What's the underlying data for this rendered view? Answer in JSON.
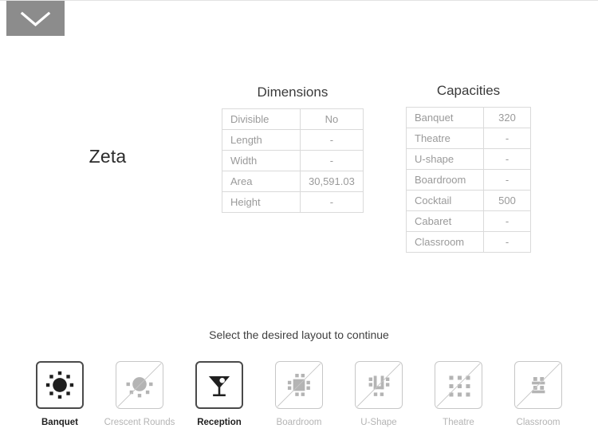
{
  "topbar": {
    "collapse_icon": "chevron-down-icon"
  },
  "room": {
    "name": "Zeta"
  },
  "dimensions": {
    "caption": "Dimensions",
    "rows": [
      {
        "label": "Divisible",
        "value": "No"
      },
      {
        "label": "Length",
        "value": "-"
      },
      {
        "label": "Width",
        "value": "-"
      },
      {
        "label": "Area",
        "value": "30,591.03"
      },
      {
        "label": "Height",
        "value": "-"
      }
    ]
  },
  "capacities": {
    "caption": "Capacities",
    "rows": [
      {
        "label": "Banquet",
        "value": "320"
      },
      {
        "label": "Theatre",
        "value": "-"
      },
      {
        "label": "U-shape",
        "value": "-"
      },
      {
        "label": "Boardroom",
        "value": "-"
      },
      {
        "label": "Cocktail",
        "value": "500"
      },
      {
        "label": "Cabaret",
        "value": "-"
      },
      {
        "label": "Classroom",
        "value": "-"
      }
    ]
  },
  "layout_selector": {
    "prompt": "Select the desired layout to continue",
    "options": [
      {
        "label": "Banquet",
        "icon": "banquet-round-table-icon",
        "enabled": true
      },
      {
        "label": "Crescent Rounds",
        "icon": "crescent-rounds-icon",
        "enabled": false
      },
      {
        "label": "Reception",
        "icon": "cocktail-glass-icon",
        "enabled": true
      },
      {
        "label": "Boardroom",
        "icon": "boardroom-table-icon",
        "enabled": false
      },
      {
        "label": "U-Shape",
        "icon": "u-shape-table-icon",
        "enabled": false
      },
      {
        "label": "Theatre",
        "icon": "theatre-seats-icon",
        "enabled": false
      },
      {
        "label": "Classroom",
        "icon": "classroom-desks-icon",
        "enabled": false
      }
    ]
  },
  "colors": {
    "enabled_ink": "#1f1f1f",
    "disabled_ink": "#b4b4b4",
    "table_border": "#dadada",
    "table_text": "#9a9a9a",
    "collapse_bg": "#8c8c8c"
  }
}
